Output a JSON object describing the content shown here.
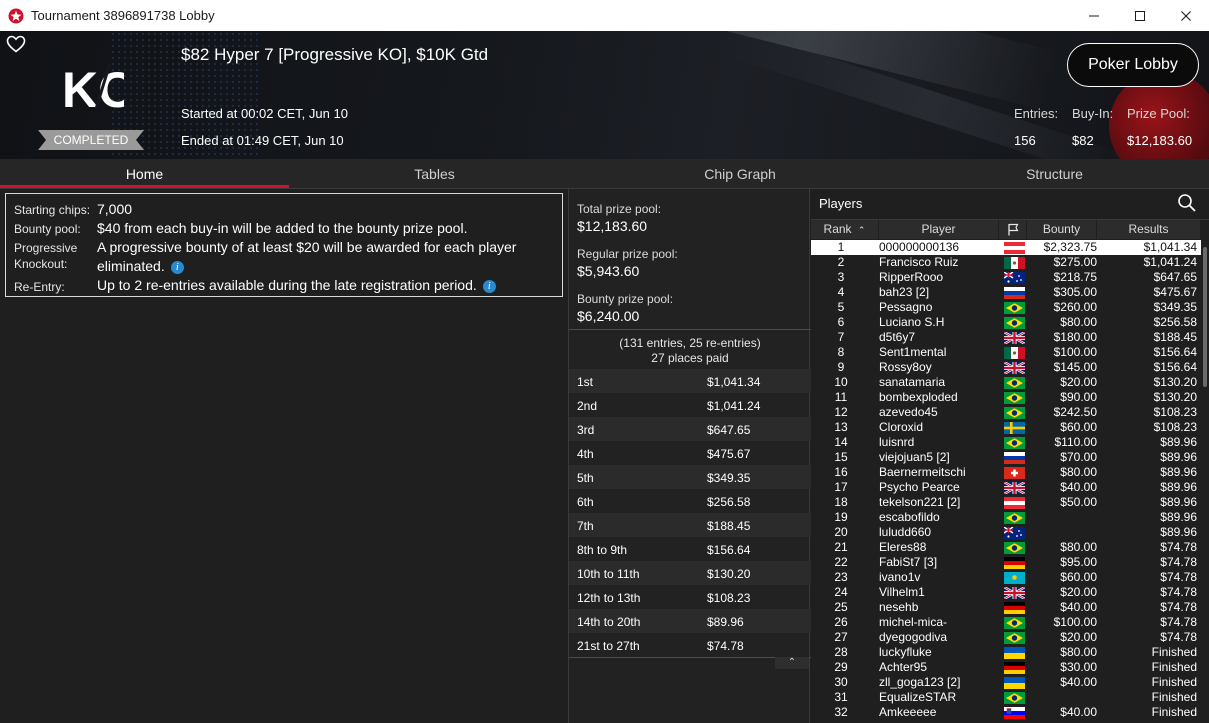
{
  "window": {
    "title": "Tournament 3896891738 Lobby",
    "controls": {
      "minimize": "—",
      "maximize": "☐",
      "close": "✕"
    }
  },
  "header": {
    "logo_text": "KO",
    "status_badge": "COMPLETED",
    "tournament_name": "$82 Hyper 7 [Progressive KO], $10K Gtd",
    "started": "Started at 00:02 CET, Jun 10",
    "ended": "Ended at 01:49 CET, Jun 10",
    "lobby_button": "Poker Lobby",
    "stats": {
      "entries_label": "Entries:",
      "entries": "156",
      "buyin_label": "Buy-In:",
      "buyin": "$82",
      "prizepool_label": "Prize Pool:",
      "prizepool": "$12,183.60"
    }
  },
  "tabs": [
    {
      "label": "Home",
      "active": true
    },
    {
      "label": "Tables",
      "active": false
    },
    {
      "label": "Chip Graph",
      "active": false
    },
    {
      "label": "Structure",
      "active": false
    }
  ],
  "home": {
    "starting_chips_label": "Starting chips:",
    "starting_chips": "7,000",
    "bounty_pool_label": "Bounty pool:",
    "bounty_pool": "$40 from each buy-in will be added to the bounty prize pool.",
    "progressive_label_1": "Progressive",
    "progressive_label_2": "Knockout:",
    "progressive_line1": "A progressive bounty of at least $20 will be awarded for each player",
    "progressive_line2": "eliminated.",
    "reentry_label": "Re-Entry:",
    "reentry": "Up to 2 re-entries available during the late registration period."
  },
  "prize": {
    "total_label": "Total prize pool:",
    "total": "$12,183.60",
    "regular_label": "Regular prize pool:",
    "regular": "$5,943.60",
    "bounty_label": "Bounty prize pool:",
    "bounty": "$6,240.00",
    "entries_note": "(131 entries, 25 re-entries)",
    "places_paid": "27 places paid",
    "payouts": [
      {
        "place": "1st",
        "amount": "$1,041.34"
      },
      {
        "place": "2nd",
        "amount": "$1,041.24"
      },
      {
        "place": "3rd",
        "amount": "$647.65"
      },
      {
        "place": "4th",
        "amount": "$475.67"
      },
      {
        "place": "5th",
        "amount": "$349.35"
      },
      {
        "place": "6th",
        "amount": "$256.58"
      },
      {
        "place": "7th",
        "amount": "$188.45"
      },
      {
        "place": "8th to 9th",
        "amount": "$156.64"
      },
      {
        "place": "10th to 11th",
        "amount": "$130.20"
      },
      {
        "place": "12th to 13th",
        "amount": "$108.23"
      },
      {
        "place": "14th to 20th",
        "amount": "$89.96"
      },
      {
        "place": "21st to 27th",
        "amount": "$74.78"
      }
    ]
  },
  "players": {
    "title": "Players",
    "columns": {
      "rank": "Rank",
      "player": "Player",
      "bounty": "Bounty",
      "results": "Results"
    },
    "rows": [
      {
        "rank": "1",
        "name": "000000000136",
        "flag": "austria",
        "bounty": "$2,323.75",
        "result": "$1,041.34"
      },
      {
        "rank": "2",
        "name": "Francisco Ruiz",
        "flag": "mexico",
        "bounty": "$275.00",
        "result": "$1,041.24"
      },
      {
        "rank": "3",
        "name": "RipperRooo",
        "flag": "australia",
        "bounty": "$218.75",
        "result": "$647.65"
      },
      {
        "rank": "4",
        "name": "bah23 [2]",
        "flag": "russia",
        "bounty": "$305.00",
        "result": "$475.67"
      },
      {
        "rank": "5",
        "name": "Pessagno",
        "flag": "brazil",
        "bounty": "$260.00",
        "result": "$349.35"
      },
      {
        "rank": "6",
        "name": "Luciano S.H",
        "flag": "brazil",
        "bounty": "$80.00",
        "result": "$256.58"
      },
      {
        "rank": "7",
        "name": "d5t6y7",
        "flag": "uk",
        "bounty": "$180.00",
        "result": "$188.45"
      },
      {
        "rank": "8",
        "name": "Sent1mental",
        "flag": "mexico",
        "bounty": "$100.00",
        "result": "$156.64"
      },
      {
        "rank": "9",
        "name": "Rossy8oy",
        "flag": "uk",
        "bounty": "$145.00",
        "result": "$156.64"
      },
      {
        "rank": "10",
        "name": "sanatamaria",
        "flag": "brazil",
        "bounty": "$20.00",
        "result": "$130.20"
      },
      {
        "rank": "11",
        "name": "bombexploded",
        "flag": "brazil",
        "bounty": "$90.00",
        "result": "$130.20"
      },
      {
        "rank": "12",
        "name": "azevedo45",
        "flag": "brazil",
        "bounty": "$242.50",
        "result": "$108.23"
      },
      {
        "rank": "13",
        "name": "Cloroxid",
        "flag": "sweden",
        "bounty": "$60.00",
        "result": "$108.23"
      },
      {
        "rank": "14",
        "name": "luisnrd",
        "flag": "brazil",
        "bounty": "$110.00",
        "result": "$89.96"
      },
      {
        "rank": "15",
        "name": "viejojuan5 [2]",
        "flag": "russia",
        "bounty": "$70.00",
        "result": "$89.96"
      },
      {
        "rank": "16",
        "name": "Baernermeitschi",
        "flag": "switzerland",
        "bounty": "$80.00",
        "result": "$89.96"
      },
      {
        "rank": "17",
        "name": "Psycho Pearce",
        "flag": "uk",
        "bounty": "$40.00",
        "result": "$89.96"
      },
      {
        "rank": "18",
        "name": "tekelson221 [2]",
        "flag": "austria",
        "bounty": "$50.00",
        "result": "$89.96"
      },
      {
        "rank": "19",
        "name": "escabofildo",
        "flag": "brazil",
        "bounty": "",
        "result": "$89.96"
      },
      {
        "rank": "20",
        "name": "luludd660",
        "flag": "australia",
        "bounty": "",
        "result": "$89.96"
      },
      {
        "rank": "21",
        "name": "Eleres88",
        "flag": "brazil",
        "bounty": "$80.00",
        "result": "$74.78"
      },
      {
        "rank": "22",
        "name": "FabiSt7 [3]",
        "flag": "germany",
        "bounty": "$95.00",
        "result": "$74.78"
      },
      {
        "rank": "23",
        "name": "ivano1v",
        "flag": "kazakhstan",
        "bounty": "$60.00",
        "result": "$74.78"
      },
      {
        "rank": "24",
        "name": "Vilhelm1",
        "flag": "uk",
        "bounty": "$20.00",
        "result": "$74.78"
      },
      {
        "rank": "25",
        "name": "nesehb",
        "flag": "germany",
        "bounty": "$40.00",
        "result": "$74.78"
      },
      {
        "rank": "26",
        "name": "michel-mica-",
        "flag": "brazil",
        "bounty": "$100.00",
        "result": "$74.78"
      },
      {
        "rank": "27",
        "name": "dyegogodiva",
        "flag": "brazil",
        "bounty": "$20.00",
        "result": "$74.78"
      },
      {
        "rank": "28",
        "name": "luckyfluke",
        "flag": "ukraine",
        "bounty": "$80.00",
        "result": "Finished"
      },
      {
        "rank": "29",
        "name": "Achter95",
        "flag": "germany",
        "bounty": "$30.00",
        "result": "Finished"
      },
      {
        "rank": "30",
        "name": "zll_goga123 [2]",
        "flag": "ukraine",
        "bounty": "$40.00",
        "result": "Finished"
      },
      {
        "rank": "31",
        "name": "EqualizeSTAR",
        "flag": "brazil",
        "bounty": "",
        "result": "Finished"
      },
      {
        "rank": "32",
        "name": "Amkeeeee",
        "flag": "slovenia",
        "bounty": "$40.00",
        "result": "Finished"
      }
    ]
  },
  "colors": {
    "accent_red": "#d0112b",
    "info_blue": "#2a8ad0"
  }
}
